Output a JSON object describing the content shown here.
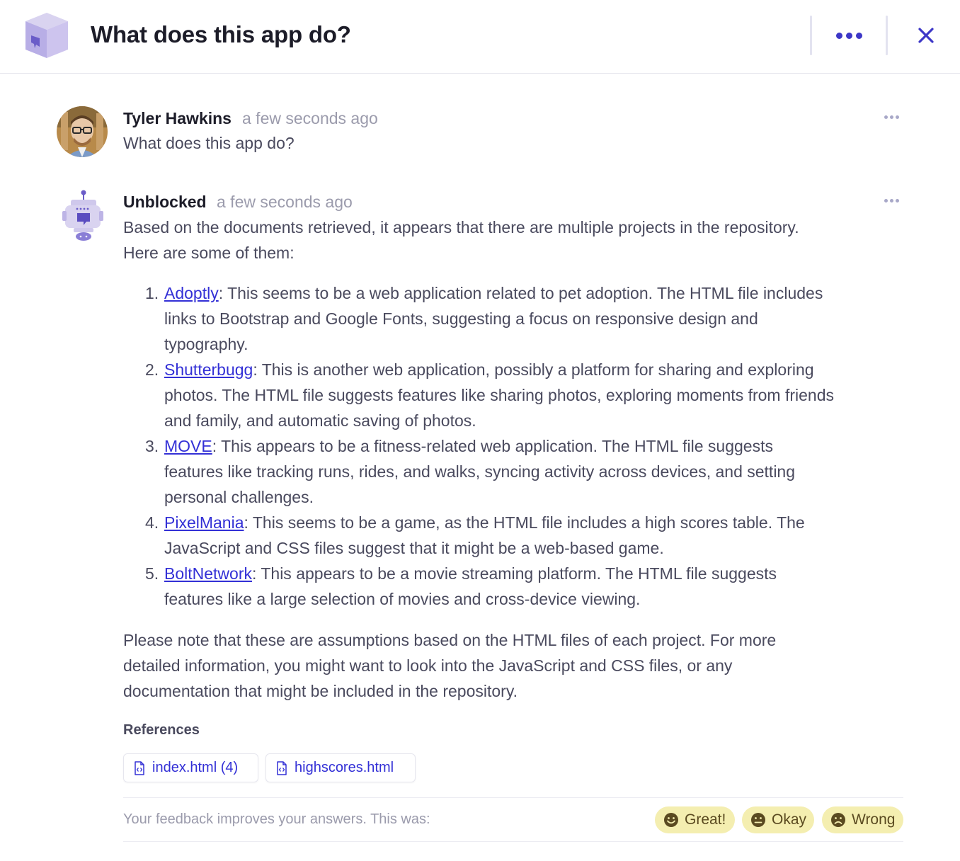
{
  "header": {
    "title": "What does this app do?",
    "more_icon": "more-horizontal-icon",
    "close_icon": "close-icon",
    "app_icon": "app-cube-logo"
  },
  "messages": [
    {
      "author": "Tyler Hawkins",
      "time": "a few seconds ago",
      "text": "What does this app do?"
    },
    {
      "author": "Unblocked",
      "time": "a few seconds ago",
      "intro_line1": "Based on the documents retrieved, it appears that there are multiple projects in the repository.",
      "intro_line2": "Here are some of them:",
      "items": [
        {
          "num": "1.",
          "link": "Adoptly",
          "lines": [
            ": This seems to be a web application related to pet adoption. The HTML file includes",
            "links to Bootstrap and Google Fonts, suggesting a focus on responsive design and",
            "typography."
          ]
        },
        {
          "num": "2.",
          "link": "Shutterbugg",
          "lines": [
            ": This is another web application, possibly a platform for sharing and exploring",
            "photos. The HTML file suggests features like sharing photos, exploring moments from friends",
            "and family, and automatic saving of photos."
          ]
        },
        {
          "num": "3.",
          "link": "MOVE",
          "lines": [
            ": This appears to be a fitness-related web application. The HTML file suggests",
            "features like tracking runs, rides, and walks, syncing activity across devices, and setting",
            "personal challenges."
          ]
        },
        {
          "num": "4.",
          "link": "PixelMania",
          "lines": [
            ": This seems to be a game, as the HTML file includes a high scores table. The",
            "JavaScript and CSS files suggest that it might be a web-based game."
          ]
        },
        {
          "num": "5.",
          "link": "BoltNetwork",
          "lines": [
            ": This appears to be a movie streaming platform. The HTML file suggests",
            "features like a large selection of movies and cross-device viewing."
          ]
        }
      ],
      "note_lines": [
        "Please note that these are assumptions based on the HTML files of each project. For more",
        "detailed information, you might want to look into the JavaScript and CSS files, or any",
        "documentation that might be included in the repository."
      ],
      "references_label": "References",
      "references": [
        {
          "label": "index.html (4)",
          "icon": "code-file-icon"
        },
        {
          "label": "highscores.html",
          "icon": "code-file-icon"
        }
      ]
    }
  ],
  "feedback": {
    "prompt": "Your feedback improves your answers. This was:",
    "options": [
      {
        "label": "Great!",
        "icon": "smile-icon"
      },
      {
        "label": "Okay",
        "icon": "neutral-face-icon"
      },
      {
        "label": "Wrong",
        "icon": "frown-icon"
      }
    ]
  },
  "colors": {
    "accent": "#3d37c7",
    "link": "#3330d6",
    "feedback_bg": "#f4eeb0"
  }
}
